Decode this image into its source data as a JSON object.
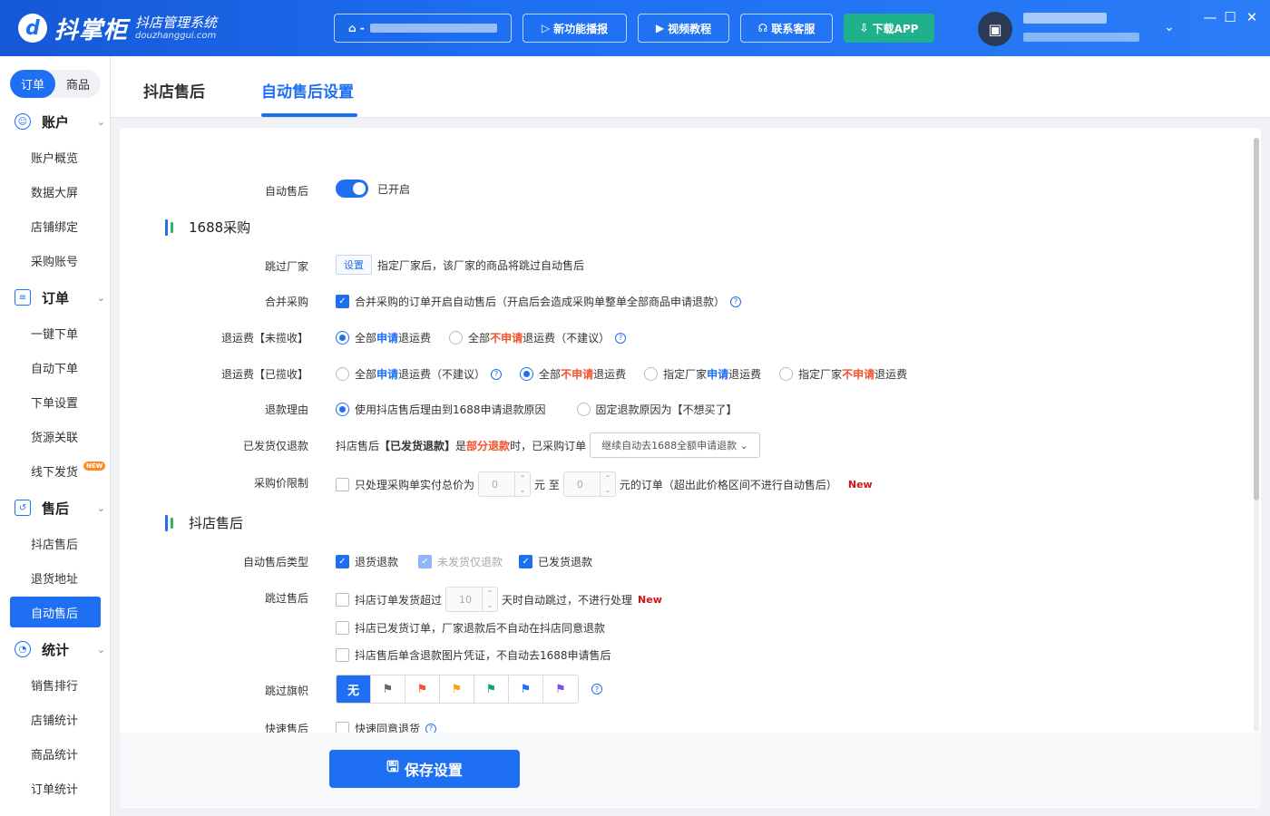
{
  "header": {
    "logo_mark": "d",
    "logo_name": "抖掌柜",
    "logo_sub": "抖店管理系统",
    "logo_url": "douzhanggui.com",
    "shop_select_prefix": "⌂ -",
    "buttons": {
      "announce": "新功能播报",
      "video": "视频教程",
      "service": "联系客服",
      "download": "下载APP"
    },
    "icons": {
      "announce": "▷",
      "video": "▶",
      "service": "☊",
      "download": "⇩",
      "caret": "⌄",
      "minimize": "—",
      "maximize": "☐",
      "close": "✕",
      "avatar": "▣"
    }
  },
  "sidebar": {
    "seg": {
      "order": "订单",
      "product": "商品"
    },
    "groups": {
      "account": {
        "label": "账户",
        "items": [
          "账户概览",
          "数据大屏",
          "店铺绑定",
          "采购账号"
        ]
      },
      "order": {
        "label": "订单",
        "items": [
          "一键下单",
          "自动下单",
          "下单设置",
          "货源关联",
          "线下发货"
        ]
      },
      "aftersale": {
        "label": "售后",
        "items": [
          "抖店售后",
          "退货地址",
          "自动售后"
        ]
      },
      "stats": {
        "label": "统计",
        "items": [
          "销售排行",
          "店铺统计",
          "商品统计",
          "订单统计"
        ]
      }
    },
    "new_badge": "NEW"
  },
  "tabs": {
    "t1": "抖店售后",
    "t2": "自动售后设置"
  },
  "form": {
    "auto": {
      "label": "自动售后",
      "value": "已开启"
    },
    "sec1688": "1688采购",
    "skip_vendor": {
      "label": "跳过厂家",
      "btn": "设置",
      "text": "指定厂家后，该厂家的商品将跳过自动售后"
    },
    "merge": {
      "label": "合并采购",
      "text": "合并采购的订单开启自动售后（开启后会造成采购单整单全部商品申请退款）"
    },
    "fee_unsigned": {
      "label": "退运费【未揽收】",
      "o1a": "全部",
      "o1b": "申请",
      "o1c": "退运费",
      "o2a": "全部",
      "o2b": "不申请",
      "o2c": "退运费（不建议）"
    },
    "fee_signed": {
      "label": "退运费【已揽收】",
      "o1a": "全部",
      "o1b": "申请",
      "o1c": "退运费（不建议）",
      "o2a": "全部",
      "o2b": "不申请",
      "o2c": "退运费",
      "o3a": "指定厂家",
      "o3b": "申请",
      "o3c": "退运费",
      "o4a": "指定厂家",
      "o4b": "不申请",
      "o4c": "退运费"
    },
    "reason": {
      "label": "退款理由",
      "o1": "使用抖店售后理由到1688申请退款原因",
      "o2": "固定退款原因为【不想买了】"
    },
    "shipped_refund": {
      "label": "已发货仅退款",
      "t1": "抖店售后",
      "t2": "【已发货退款】",
      "t3": "是",
      "t4": "部分退款",
      "t5": "时，已采购订单",
      "select": "继续自动去1688全额申请退款"
    },
    "price_limit": {
      "label": "采购价限制",
      "t1": "只处理采购单实付总价为",
      "v1": "0",
      "t2": "元 至",
      "v2": "0",
      "t3": "元的订单（超出此价格区间不进行自动售后）",
      "new": "New"
    },
    "sec_douyin": "抖店售后",
    "types": {
      "label": "自动售后类型",
      "o1": "退货退款",
      "o2": "未发货仅退款",
      "o3": "已发货退款"
    },
    "skip_as": {
      "label": "跳过售后",
      "l1a": "抖店订单发货超过",
      "l1v": "10",
      "l1b": "天时自动跳过，不进行处理",
      "new": "New",
      "l2": "抖店已发货订单，厂家退款后不自动在抖店同意退款",
      "l3": "抖店售后单含退款图片凭证，不自动去1688申请售后"
    },
    "flags": {
      "label": "跳过旗帜",
      "none": "无",
      "glyph": "⚑"
    },
    "quick": {
      "label": "快速售后",
      "text": "快速同意退货"
    }
  },
  "save": {
    "label": "保存设置",
    "icon": "🖫"
  },
  "colors": {
    "brand": "#1e6ff2",
    "red": "#f5512b",
    "green": "#1fb18a"
  },
  "flag_colors": [
    "#666666",
    "#f5512b",
    "#ff9f1a",
    "#15a37c",
    "#1e6ff2",
    "#7b4fe0"
  ]
}
